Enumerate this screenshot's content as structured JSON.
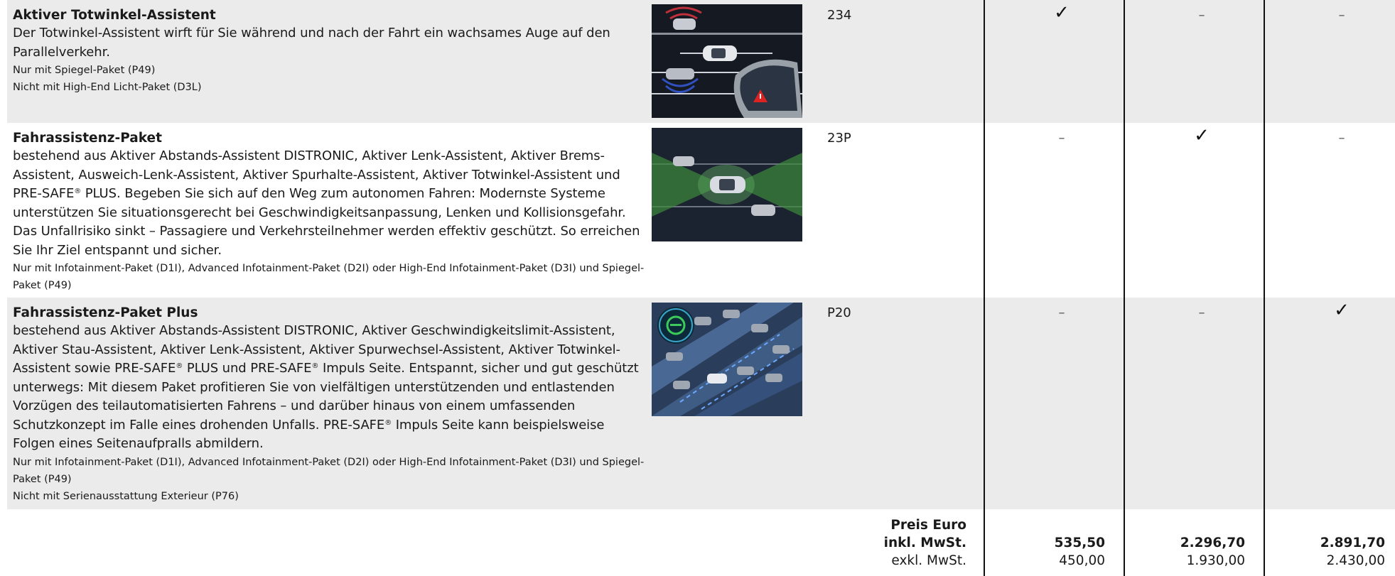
{
  "rows": [
    {
      "title": "Aktiver Totwinkel-Assistent",
      "body": "Der Totwinkel-Assistent wirft für Sie während und nach der Fahrt ein wachsames Auge auf den Parallelverkehr.",
      "notes": [
        "Nur mit Spiegel-Paket (P49)",
        "Nicht mit High-End Licht-Paket (D3L)"
      ],
      "code": "234",
      "marks": [
        "✓",
        "–",
        "–"
      ]
    },
    {
      "title": "Fahrassistenz-Paket",
      "body_parts": [
        "bestehend aus Aktiver Abstands-Assistent DISTRONIC, Aktiver Lenk-Assistent, Aktiver Brems-Assistent, Ausweich-Lenk-Assistent, Aktiver Spurhalte-Assistent, Aktiver Totwinkel-Assistent und PRE-SAFE",
        "®",
        " PLUS. Begeben Sie sich auf den Weg zum autonomen Fahren: Modernste Systeme unterstützen Sie situationsgerecht bei Geschwindigkeitsanpassung, Lenken und Kollisionsgefahr. Das Unfallrisiko sinkt – Passagiere und Verkehrsteilnehmer werden effektiv geschützt. So erreichen Sie Ihr Ziel entspannt und sicher."
      ],
      "notes": [
        "Nur mit Infotainment-Paket (D1I), Advanced Infotainment-Paket (D2I) oder High-End Infotainment-Paket (D3I) und Spiegel-Paket (P49)"
      ],
      "code": "23P",
      "marks": [
        "–",
        "✓",
        "–"
      ]
    },
    {
      "title": "Fahrassistenz-Paket Plus",
      "body_parts": [
        "bestehend aus Aktiver Abstands-Assistent DISTRONIC, Aktiver Geschwindigkeitslimit-Assistent, Aktiver Stau-Assistent, Aktiver Lenk-Assistent, Aktiver Spurwechsel-Assistent, Aktiver Totwinkel-Assistent sowie PRE-SAFE",
        "®",
        " PLUS und PRE-SAFE",
        "®",
        " Impuls Seite. Entspannt, sicher und gut geschützt unterwegs: Mit diesem Paket profitieren Sie von vielfältigen unterstützenden und entlastenden Vorzügen des teilautomatisierten Fahrens – und darüber hinaus von einem umfassenden Schutzkonzept im Falle eines drohenden Unfalls. PRE-SAFE",
        "®",
        " Impuls Seite kann beispielsweise Folgen eines Seitenaufpralls abmildern."
      ],
      "notes": [
        "Nur mit Infotainment-Paket (D1I), Advanced Infotainment-Paket (D2I) oder High-End Infotainment-Paket (D3I) und Spiegel-Paket (P49)",
        "Nicht mit Serienausstattung Exterieur (P76)"
      ],
      "code": "P20",
      "marks": [
        "–",
        "–",
        "✓"
      ]
    }
  ],
  "price": {
    "label_line1": "Preis Euro",
    "label_incl": "inkl. MwSt.",
    "label_excl": "exkl. MwSt.",
    "incl": [
      "535,50",
      "2.296,70",
      "2.891,70"
    ],
    "excl": [
      "450,00",
      "1.930,00",
      "2.430,00"
    ]
  }
}
